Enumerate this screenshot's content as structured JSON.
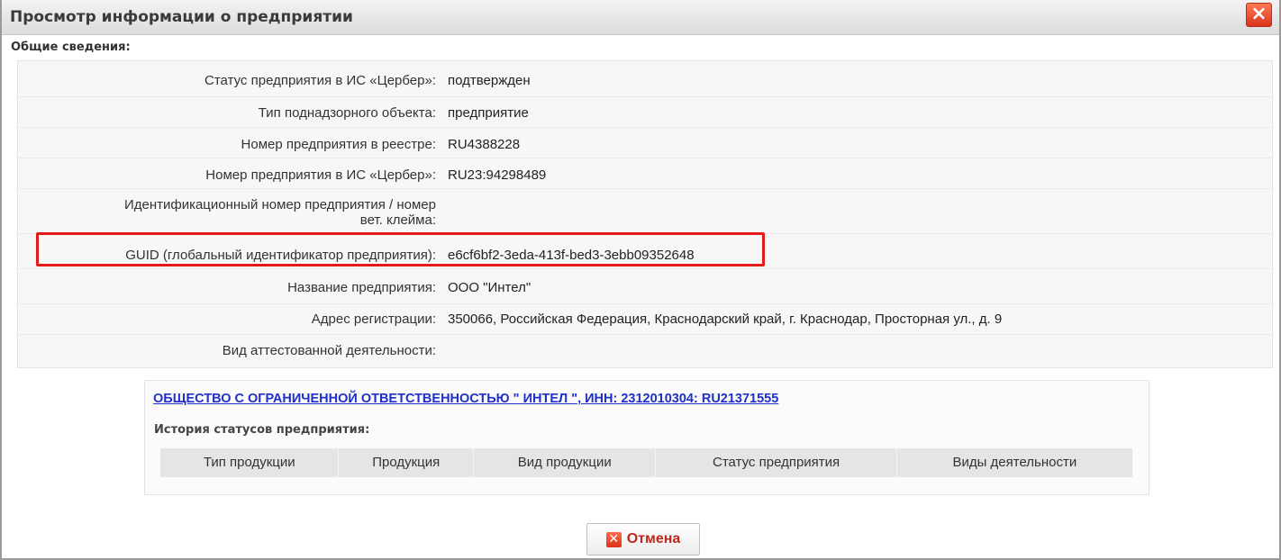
{
  "dialog": {
    "title": "Просмотр информации о предприятии",
    "close_icon": "×"
  },
  "general": {
    "section_title": "Общие сведения:",
    "rows": [
      {
        "label": "Статус предприятия в ИС «Цербер»:",
        "value": "подтвержден"
      },
      {
        "label": "Тип поднадзорного объекта:",
        "value": "предприятие"
      },
      {
        "label": "Номер предприятия в реестре:",
        "value": "RU4388228"
      },
      {
        "label": "Номер предприятия в ИС «Цербер»:",
        "value": "RU23:94298489"
      },
      {
        "label_line1": "Идентификационный номер предприятия / номер",
        "label_line2": "вет. клейма:",
        "value": ""
      },
      {
        "label": "GUID (глобальный идентификатор предприятия):",
        "value": "e6cf6bf2-3eda-413f-bed3-3ebb09352648"
      },
      {
        "label": "Название предприятия:",
        "value": "ООО \"Интел\""
      },
      {
        "label": "Адрес регистрации:",
        "value": "350066, Российская Федерация, Краснодарский край, г. Краснодар, Просторная ул., д. 9"
      },
      {
        "label": "Вид аттестованной деятельности:",
        "value": ""
      }
    ]
  },
  "organization": {
    "link_text": "ОБЩЕСТВО С ОГРАНИЧЕННОЙ ОТВЕТСТВЕННОСТЬЮ \" ИНТЕЛ \", ИНН: 2312010304: RU21371555",
    "history_title": "История статусов предприятия:",
    "history_columns": [
      "Тип продукции",
      "Продукция",
      "Вид продукции",
      "Статус предприятия",
      "Виды деятельности"
    ]
  },
  "actions": {
    "cancel_label": "Отмена",
    "cancel_icon": "✕"
  },
  "colors": {
    "highlight": "#e21a1a",
    "link": "#1f2fc9",
    "cancel": "#c0271a"
  }
}
